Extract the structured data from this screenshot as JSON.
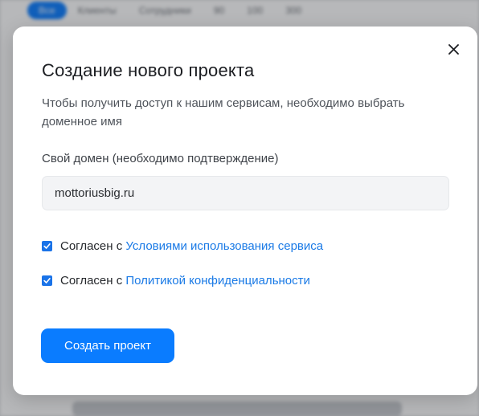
{
  "background": {
    "tabs": [
      "Все",
      "Клиенты",
      "Сотрудники",
      "90",
      "100",
      "300"
    ]
  },
  "modal": {
    "title": "Создание нового проекта",
    "subtitle": "Чтобы получить доступ к нашим сервисам, необходимо выбрать доменное имя",
    "close_icon": "close-icon",
    "field_label": "Свой домен (необходимо подтверждение)",
    "domain_value": "mottoriusbig.ru",
    "agreements": [
      {
        "prefix": "Согласен с ",
        "link": "Условиями использования сервиса",
        "checked": true
      },
      {
        "prefix": "Согласен с ",
        "link": "Политикой конфиденциальности",
        "checked": true
      }
    ],
    "submit_label": "Создать проект"
  },
  "colors": {
    "accent": "#0a7cff",
    "link": "#1a7ae6",
    "checkbox": "#1a73e8"
  }
}
